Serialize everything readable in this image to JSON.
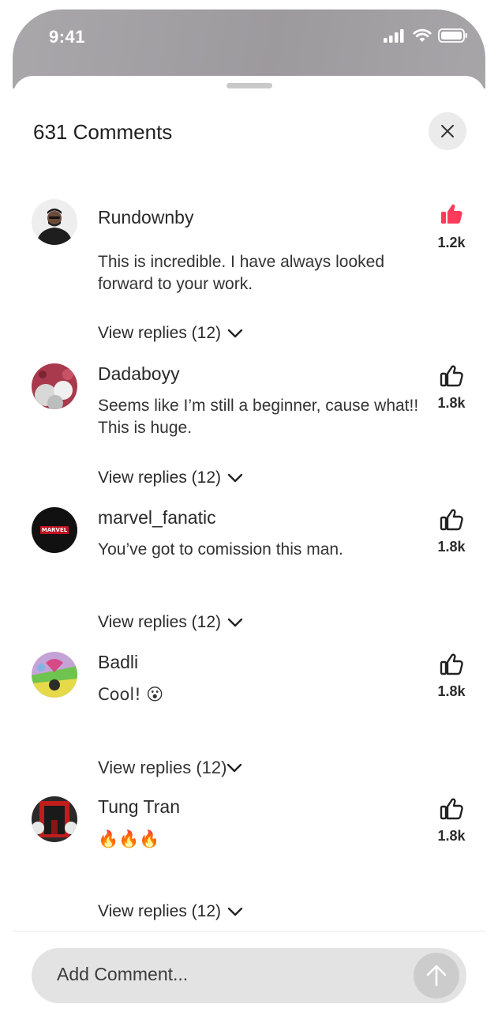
{
  "status_bar": {
    "time": "9:41"
  },
  "header": {
    "title": "631 Comments"
  },
  "comments": [
    {
      "username": "Rundownby",
      "text": "This is incredible. I have always looked forward to your work.",
      "likes": "1.2k",
      "liked": true,
      "view_replies": "View replies (12)"
    },
    {
      "username": "Dadaboyy",
      "text": "Seems like I’m still a beginner, cause what!! This is huge.",
      "likes": "1.8k",
      "liked": false,
      "view_replies": "View replies (12)"
    },
    {
      "username": "marvel_fanatic",
      "text": "You’ve got to comission this man.",
      "likes": "1.8k",
      "liked": false,
      "view_replies": "View replies (12)",
      "avatar_text": "MARVEL"
    },
    {
      "username": "Badli",
      "text": "Cool! 😮",
      "likes": "1.8k",
      "liked": false,
      "view_replies": "View replies (12)"
    },
    {
      "username": "Tung Tran",
      "text": "🔥🔥🔥",
      "likes": "1.8k",
      "liked": false,
      "view_replies": "View replies (12)"
    }
  ],
  "composer": {
    "placeholder": "Add Comment..."
  },
  "colors": {
    "like_active": "#ff3b5c",
    "like_inactive": "#222222",
    "status_bar": "#a3a1a4"
  },
  "icons": [
    "signal-icon",
    "wifi-icon",
    "battery-icon",
    "close-icon",
    "thumbs-up-icon",
    "chevron-down-icon",
    "arrow-up-icon"
  ]
}
